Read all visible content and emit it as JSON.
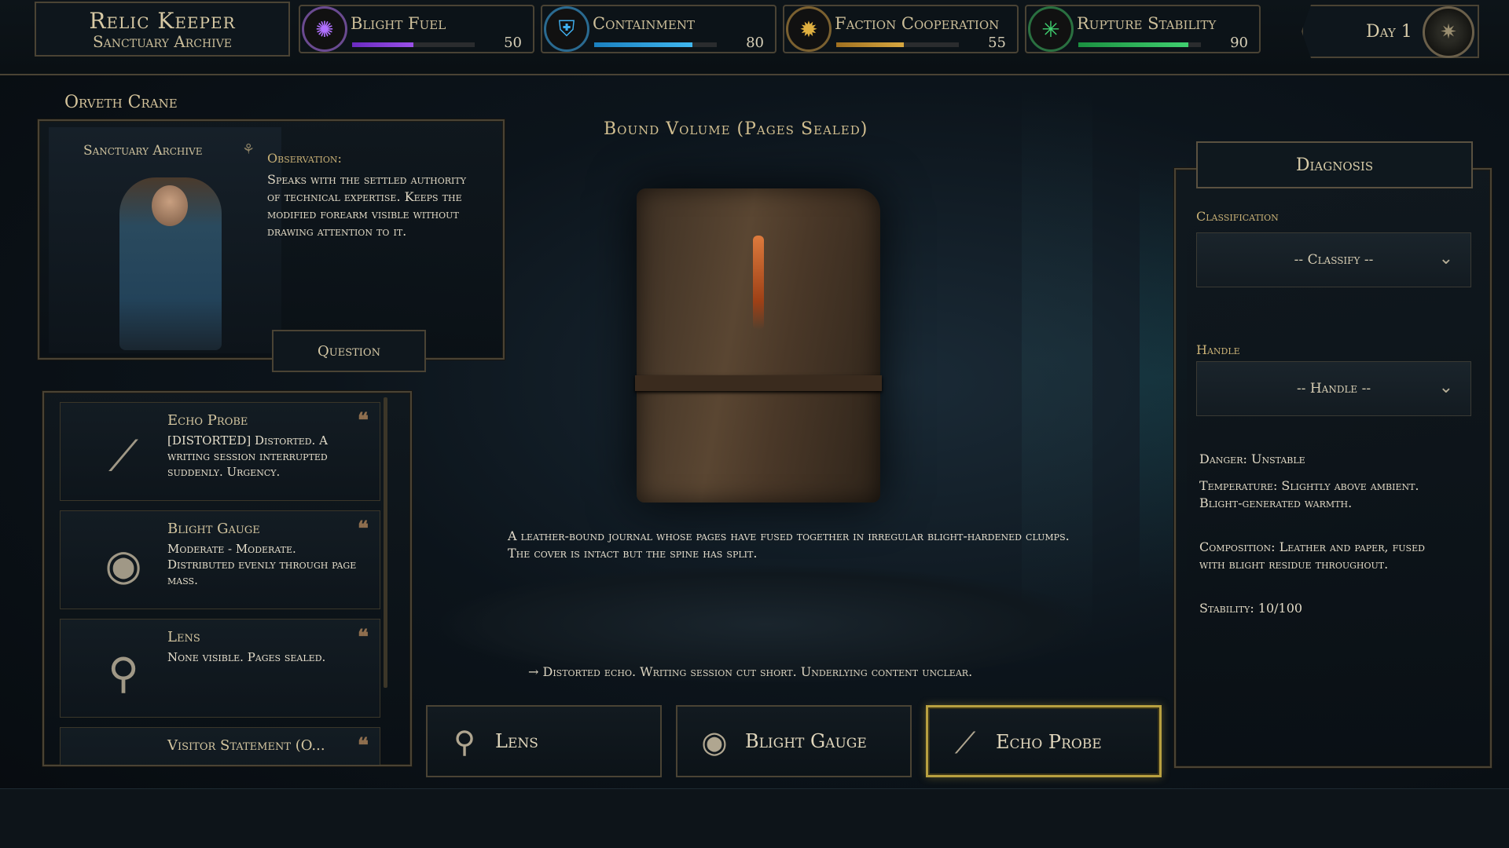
{
  "title": {
    "line1": "Relic Keeper",
    "line2": "Sanctuary Archive"
  },
  "stats": [
    {
      "label": "Blight Fuel",
      "value": "50",
      "pct": 0.5,
      "color": "#8a3ad8",
      "icon": "blight-icon",
      "glyph": "✺"
    },
    {
      "label": "Containment",
      "value": "80",
      "pct": 0.8,
      "color": "#2aa0e0",
      "icon": "shield-icon",
      "glyph": "⛨"
    },
    {
      "label": "Faction Cooperation",
      "value": "55",
      "pct": 0.55,
      "color": "#c9962a",
      "icon": "sun-icon",
      "glyph": "✹"
    },
    {
      "label": "Rupture Stability",
      "value": "90",
      "pct": 0.9,
      "color": "#2ab050",
      "icon": "star-icon",
      "glyph": "✳"
    }
  ],
  "day": {
    "label": "Day 1",
    "icon": "compass-dial-icon"
  },
  "visitor": {
    "name": "Orveth Crane",
    "location": "Sanctuary Archive",
    "observation_title": "Observation:",
    "observation_text": "Speaks with the settled authority of technical expertise. Keeps the modified forearm visible without drawing attention to it.",
    "question_label": "Question"
  },
  "evidence": [
    {
      "name": "Echo Probe",
      "desc": "[DISTORTED] Distorted. A writing session interrupted suddenly. Urgency.",
      "icon": "echo-probe-icon",
      "glyph": "⟋"
    },
    {
      "name": "Blight Gauge",
      "desc": "Moderate - Moderate. Distributed evenly through page mass.",
      "icon": "blight-gauge-icon",
      "glyph": "◉"
    },
    {
      "name": "Lens",
      "desc": "None visible. Pages sealed.",
      "icon": "lens-icon",
      "glyph": "⚲"
    },
    {
      "name": "Visitor Statement (O...",
      "desc": "",
      "icon": "statement-icon",
      "glyph": ""
    }
  ],
  "item": {
    "title": "Bound Volume (Pages Sealed)",
    "description": "A leather-bound journal whose pages have fused together in irregular blight-hardened clumps. The cover is intact but the spine has split.",
    "result": "→ Distorted echo. Writing session cut short. Underlying content unclear."
  },
  "tools": [
    {
      "label": "Lens",
      "icon": "lens-icon",
      "glyph": "⚲",
      "active": false
    },
    {
      "label": "Blight Gauge",
      "icon": "blight-gauge-icon",
      "glyph": "◉",
      "active": false
    },
    {
      "label": "Echo Probe",
      "icon": "echo-probe-icon",
      "glyph": "⟋",
      "active": true
    }
  ],
  "diagnosis": {
    "title": "Diagnosis",
    "classification_label": "Classification",
    "classification_value": "-- Classify --",
    "handle_label": "Handle",
    "handle_value": "-- Handle --",
    "danger": "Danger: Unstable",
    "temperature": "Temperature: Slightly above ambient. Blight-generated warmth.",
    "composition": "Composition: Leather and paper, fused with blight residue throughout.",
    "stability": "Stability: 10/100"
  },
  "colors": {
    "accent_gold": "#c9b176",
    "border": "#4a4334",
    "active_border": "#b8a040"
  }
}
